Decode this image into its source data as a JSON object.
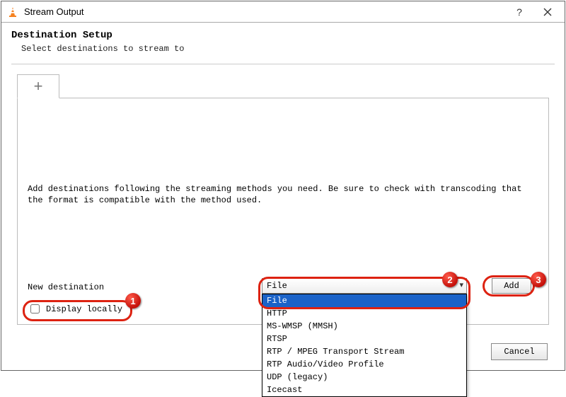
{
  "window": {
    "title": "Stream Output"
  },
  "header": {
    "title": "Destination Setup",
    "subtitle": "Select destinations to stream to"
  },
  "main": {
    "description": "Add destinations following the streaming methods you need. Be sure to check with transcoding that the format is compatible with the method used.",
    "new_destination_label": "New destination",
    "display_locally_label": "Display locally",
    "display_locally_checked": false,
    "dest_select": {
      "selected": "File",
      "options": [
        "File",
        "HTTP",
        "MS-WMSP (MMSH)",
        "RTSP",
        "RTP / MPEG Transport Stream",
        "RTP Audio/Video Profile",
        "UDP (legacy)",
        "Icecast"
      ],
      "highlighted_index": 0
    },
    "add_label": "Add"
  },
  "footer": {
    "cancel_label": "Cancel"
  },
  "annotations": {
    "n1": "1",
    "n2": "2",
    "n3": "3"
  }
}
